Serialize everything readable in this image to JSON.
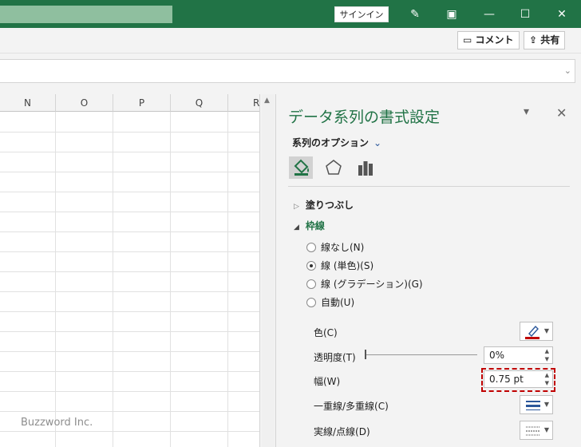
{
  "titlebar": {
    "signin_label": "サインイン"
  },
  "ribbon": {
    "comment_label": "コメント",
    "share_label": "共有"
  },
  "grid": {
    "columns": [
      "N",
      "O",
      "P",
      "Q",
      "R"
    ]
  },
  "watermark": "Buzzword Inc.",
  "pane": {
    "title": "データ系列の書式設定",
    "options_label": "系列のオプション",
    "fill_section": "塗りつぶし",
    "line_section": "枠線",
    "line_options": [
      "線なし(N)",
      "線 (単色)(S)",
      "線 (グラデーション)(G)",
      "自動(U)"
    ],
    "selected_option_index": 1,
    "color_label": "色(C)",
    "color_value": "#c00000",
    "transparency_label": "透明度(T)",
    "transparency_value": "0%",
    "width_label": "幅(W)",
    "width_value": "0.75 pt",
    "compound_label": "一重線/多重線(C)",
    "dash_label": "実線/点線(D)"
  },
  "colors": {
    "brand": "#217346",
    "highlight": "#c00000"
  }
}
